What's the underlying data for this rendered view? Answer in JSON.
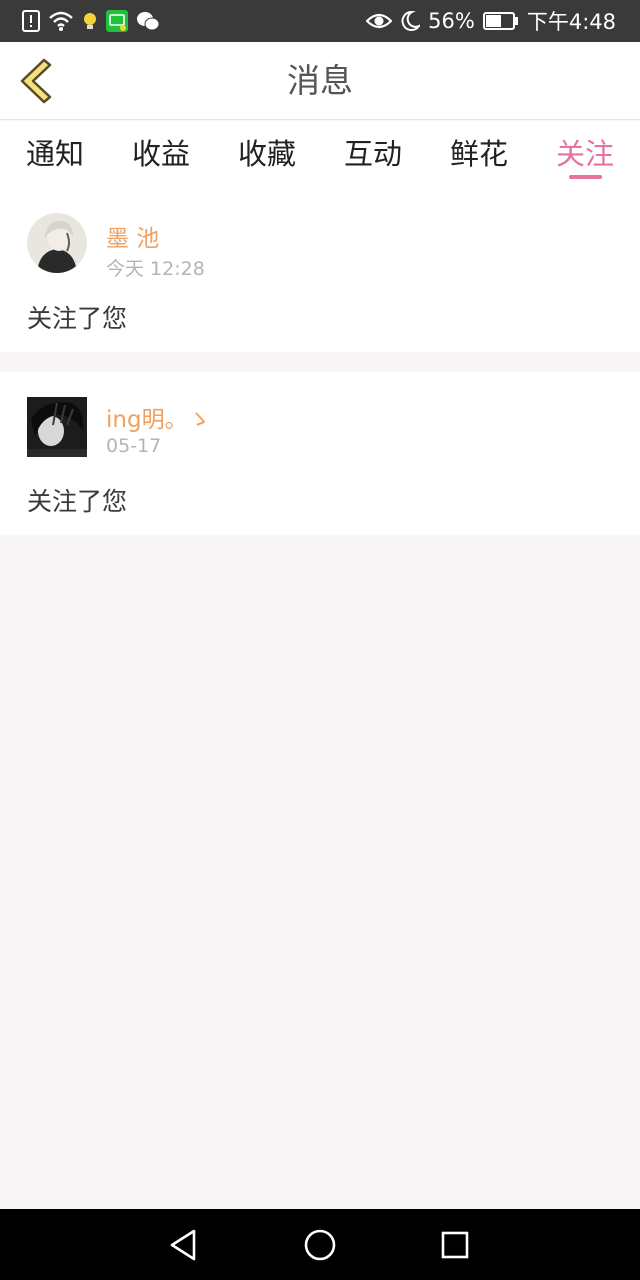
{
  "status_bar": {
    "battery_percent": "56%",
    "time": "下午4:48",
    "icons": [
      "alert-icon",
      "wifi-icon",
      "bulb-icon",
      "iqiyi-icon",
      "wechat-icon",
      "eye-icon",
      "moon-icon",
      "battery-icon"
    ]
  },
  "header": {
    "title": "消息",
    "back_icon": "chevron-left-icon"
  },
  "tabs": [
    {
      "label": "通知"
    },
    {
      "label": "收益"
    },
    {
      "label": "收藏"
    },
    {
      "label": "互动"
    },
    {
      "label": "鲜花"
    },
    {
      "label": "关注",
      "active": true
    }
  ],
  "messages": [
    {
      "username": "墨 池",
      "time": "今天 12:28",
      "text": "关注了您"
    },
    {
      "username": "ing明。ゝ",
      "time": "05-17",
      "text": "关注了您"
    }
  ],
  "colors": {
    "accent": "#e7729f",
    "username": "#f0a060",
    "time": "#b4b4b4",
    "back_icon_fill": "#f4e27a"
  },
  "nav_bar": {
    "buttons": [
      "back-triangle-icon",
      "home-circle-icon",
      "recent-square-icon"
    ]
  }
}
